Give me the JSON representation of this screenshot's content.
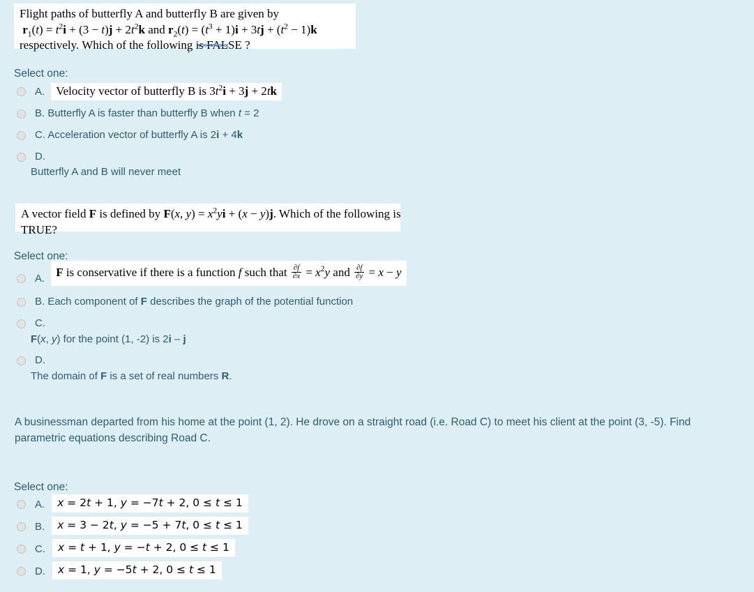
{
  "page": {
    "background_color": "#ddeff5",
    "text_color": "#2d5c6e",
    "stem_box_color": "#ffffff"
  },
  "questions": [
    {
      "id": "q1",
      "stem_lines": [
        "Flight paths of butterfly A and butterfly B are given by",
        "r₁(t) = t²i + (3 − t)j + 2t²k and r₂(t) = (t³ + 1)i + 3tj + (t² − 1)k",
        "respectively. Which of the following is FALSE ?"
      ],
      "select_label": "Select one:",
      "options": [
        {
          "label": "A.",
          "text": "Velocity vector of butterfly B is 3t²i + 3j + 2tk",
          "style": "math-box",
          "layout": "inline"
        },
        {
          "label": "B.",
          "text": "Butterfly A is faster than butterfly B when t = 2",
          "style": "plain",
          "layout": "inline"
        },
        {
          "label": "C.",
          "text": "Acceleration vector of butterfly A is 2i + 4k",
          "style": "plain",
          "layout": "inline"
        },
        {
          "label": "D.",
          "text": "Butterfly A and B will never meet",
          "style": "plain",
          "layout": "stacked"
        }
      ]
    },
    {
      "id": "q2",
      "stem_lines": [
        "A vector field F is defined by F(x, y) = x²yi + (x − y)j. Which of the following is",
        "TRUE?"
      ],
      "select_label": "Select one:",
      "options": [
        {
          "label": "A.",
          "text": "F is conservative if there is a function f such that ∂f/∂x = x²y and ∂f/∂y = x − y",
          "style": "math-box",
          "layout": "inline"
        },
        {
          "label": "B.",
          "text": "Each component of F describes the graph of the potential function",
          "style": "plain",
          "layout": "inline"
        },
        {
          "label": "C.",
          "text": "F(x, y) for the point (1, -2) is 2i – j",
          "style": "plain",
          "layout": "stacked"
        },
        {
          "label": "D.",
          "text": "The domain of F is a set of real numbers R.",
          "style": "plain",
          "layout": "stacked"
        }
      ]
    },
    {
      "id": "q3",
      "stem_lines": [
        "A businessman departed from his home at the point (1, 2). He drove on a straight road (i.e. Road C) to meet his client at the point (3, -5). Find",
        "parametric equations describing Road C."
      ],
      "select_label": "Select one:",
      "options": [
        {
          "label": "A.",
          "text": "x = 2t + 1, y = −7t + 2, 0 ≤ t ≤ 1",
          "style": "sans-math-box",
          "layout": "inline"
        },
        {
          "label": "B.",
          "text": "x = 3 − 2t, y = −5 + 7t, 0 ≤ t ≤ 1",
          "style": "sans-math-box",
          "layout": "inline"
        },
        {
          "label": "C.",
          "text": "x = t + 1, y = −t + 2, 0 ≤ t ≤ 1",
          "style": "sans-math-box",
          "layout": "inline"
        },
        {
          "label": "D.",
          "text": "x = 1, y = −5t + 2, 0 ≤ t ≤ 1",
          "style": "sans-math-box",
          "layout": "inline"
        }
      ]
    }
  ]
}
